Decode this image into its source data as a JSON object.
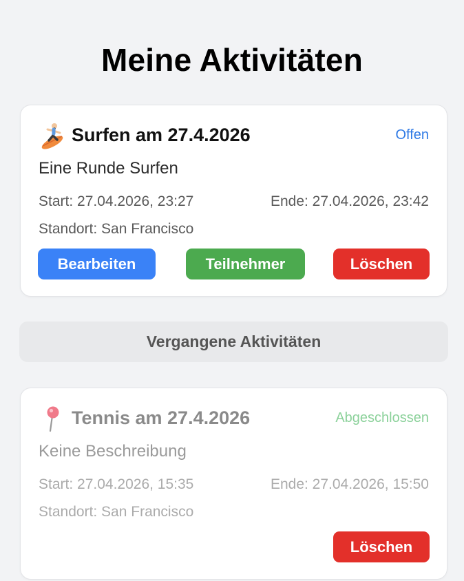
{
  "page": {
    "title": "Meine Aktivitäten"
  },
  "upcoming": [
    {
      "icon": "surfer-icon",
      "title": "Surfen am 27.4.2026",
      "status": "Offen",
      "description": "Eine Runde Surfen",
      "start": "Start: 27.04.2026, 23:27",
      "end": "Ende: 27.04.2026, 23:42",
      "location": "Standort: San Francisco",
      "buttons": {
        "edit": "Bearbeiten",
        "participants": "Teilnehmer",
        "delete": "Löschen"
      }
    }
  ],
  "past_section": {
    "label": "Vergangene Aktivitäten"
  },
  "past": [
    {
      "icon": "pin-icon",
      "title": "Tennis am 27.4.2026",
      "status": "Abgeschlossen",
      "description": "Keine Beschreibung",
      "start": "Start: 27.04.2026, 15:35",
      "end": "Ende: 27.04.2026, 15:50",
      "location": "Standort: San Francisco",
      "buttons": {
        "delete": "Löschen"
      }
    }
  ],
  "colors": {
    "primary": "#3a82f7",
    "success": "#4caa4f",
    "danger": "#e3302a",
    "status_open": "#2f7ae5",
    "status_done": "#8bd19a"
  }
}
